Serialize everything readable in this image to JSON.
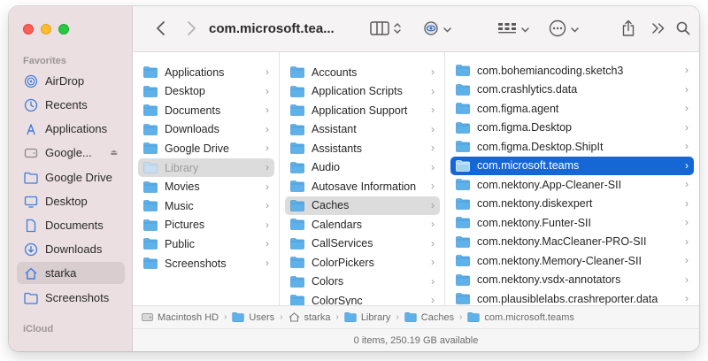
{
  "window": {
    "title": "com.microsoft.teа..."
  },
  "sidebar": {
    "favorites_label": "Favorites",
    "icloud_label": "iCloud",
    "items": [
      {
        "label": "AirDrop",
        "icon": "airdrop-icon"
      },
      {
        "label": "Recents",
        "icon": "clock-icon"
      },
      {
        "label": "Applications",
        "icon": "applications-icon"
      },
      {
        "label": "Google...",
        "icon": "drive-icon"
      },
      {
        "label": "Google Drive",
        "icon": "folder-icon"
      },
      {
        "label": "Desktop",
        "icon": "desktop-icon"
      },
      {
        "label": "Documents",
        "icon": "document-icon"
      },
      {
        "label": "Downloads",
        "icon": "download-icon"
      },
      {
        "label": "starka",
        "icon": "home-icon"
      },
      {
        "label": "Screenshots",
        "icon": "folder-icon"
      }
    ]
  },
  "columns": {
    "col1": [
      "Applications",
      "Desktop",
      "Documents",
      "Downloads",
      "Google Drive",
      "Library",
      "Movies",
      "Music",
      "Pictures",
      "Public",
      "Screenshots"
    ],
    "col2": [
      "Accounts",
      "Application Scripts",
      "Application Support",
      "Assistant",
      "Assistants",
      "Audio",
      "Autosave Information",
      "Caches",
      "Calendars",
      "CallServices",
      "ColorPickers",
      "Colors",
      "ColorSync"
    ],
    "col3": [
      "com.bohemiancoding.sketch3",
      "com.crashlytics.data",
      "com.figma.agent",
      "com.figma.Desktop",
      "com.figma.Desktop.ShipIt",
      "com.microsoft.teams",
      "com.nektony.App-Cleaner-SII",
      "com.nektony.diskexpert",
      "com.nektony.Funter-SII",
      "com.nektony.MacCleaner-PRO-SII",
      "com.nektony.Memory-Cleaner-SII",
      "com.nektony.vsdx-annotators",
      "com.plausiblelabs.crashreporter.data"
    ]
  },
  "pathbar": [
    "Macintosh HD",
    "Users",
    "starka",
    "Library",
    "Caches",
    "com.microsoft.teams"
  ],
  "status": "0 items, 250.19 GB available",
  "colors": {
    "accent": "#1667d6",
    "folder": "#5fb1ea",
    "sidebar_bg": "#ecdfe2"
  }
}
